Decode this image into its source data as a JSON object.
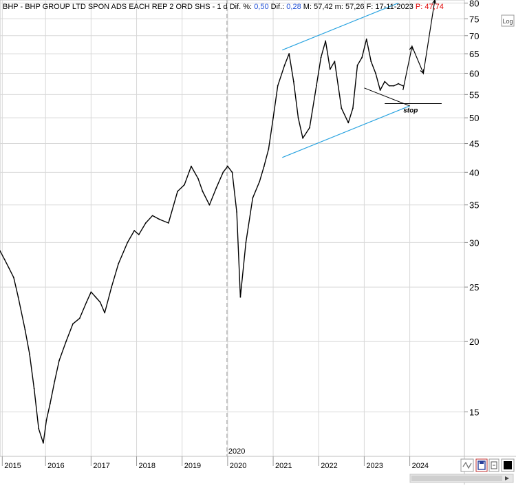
{
  "header": {
    "ticker": "BHP",
    "name": "BHP GROUP LTD SPON ADS EACH REP 2 ORD SHS",
    "timeframe": "1 d",
    "dif_pct_label": "Dif. %:",
    "dif_pct_value": "0,50",
    "dif_label": "Dif.:",
    "dif_value": "0,28",
    "max_label": "M:",
    "max_value": "57,42",
    "min_label": "m:",
    "min_value": "57,26",
    "date_label": "F:",
    "date_value": "17-11-2023",
    "p_label": "P:",
    "p_value": "47,74"
  },
  "buttons": {
    "log_label": "Log"
  },
  "colors": {
    "channel": "#29a3e0",
    "price": "#000000",
    "grid": "#d8d8d8",
    "header_value": "#1f4fd6",
    "header_p": "#e00000"
  },
  "chart_data": {
    "type": "line",
    "title": "",
    "y_scale": "log",
    "ylim": [
      12.5,
      81
    ],
    "xlim": [
      2015.0,
      2025.2
    ],
    "y_ticks": [
      15,
      20,
      25,
      30,
      35,
      40,
      45,
      50,
      55,
      60,
      65,
      70,
      75,
      80
    ],
    "x_ticks": [
      {
        "value": 2015.05,
        "label": "2015"
      },
      {
        "value": 2016.0,
        "label": "2016"
      },
      {
        "value": 2017.0,
        "label": "2017"
      },
      {
        "value": 2018.0,
        "label": "2018"
      },
      {
        "value": 2019.0,
        "label": "2019"
      },
      {
        "value": 2020.0,
        "label": "2020"
      },
      {
        "value": 2021.0,
        "label": "2021"
      },
      {
        "value": 2022.0,
        "label": "2022"
      },
      {
        "value": 2023.0,
        "label": "2023"
      },
      {
        "value": 2024.0,
        "label": "2024"
      }
    ],
    "vertical_marker": {
      "x": 2020.0,
      "label": "2020"
    },
    "series": [
      {
        "x": [
          2015.0,
          2015.1,
          2015.2,
          2015.3,
          2015.4,
          2015.55,
          2015.65,
          2015.75,
          2015.85,
          2015.95,
          2016.02,
          2016.1,
          2016.2,
          2016.3,
          2016.45,
          2016.6,
          2016.75,
          2016.9,
          2017.0,
          2017.1,
          2017.2,
          2017.3,
          2017.45,
          2017.6,
          2017.8,
          2017.95,
          2018.05,
          2018.2,
          2018.35,
          2018.5,
          2018.7,
          2018.9,
          2019.05,
          2019.2,
          2019.35,
          2019.45,
          2019.6,
          2019.75,
          2019.9,
          2020.0,
          2020.1,
          2020.2,
          2020.28,
          2020.4,
          2020.55,
          2020.7,
          2020.8,
          2020.9,
          2021.0,
          2021.1,
          2021.25,
          2021.35,
          2021.45,
          2021.55,
          2021.65,
          2021.8,
          2021.95,
          2022.05,
          2022.15,
          2022.25,
          2022.35,
          2022.5,
          2022.65,
          2022.75,
          2022.85,
          2022.95,
          2023.05,
          2023.15,
          2023.25,
          2023.35,
          2023.45,
          2023.55,
          2023.65,
          2023.75,
          2023.85
        ],
        "values": [
          29.0,
          28.0,
          27.0,
          26.0,
          24.0,
          21.0,
          19.0,
          16.5,
          14.0,
          13.2,
          14.5,
          15.5,
          17.0,
          18.5,
          20.0,
          21.5,
          22.0,
          23.5,
          24.5,
          24.0,
          23.5,
          22.5,
          25.0,
          27.5,
          30.0,
          31.5,
          31.0,
          32.5,
          33.5,
          33.0,
          32.5,
          37.0,
          38.0,
          41.0,
          39.0,
          37.0,
          35.0,
          37.5,
          40.0,
          41.0,
          40.0,
          34.0,
          24.0,
          30.0,
          36.0,
          38.5,
          41.0,
          44.0,
          50.0,
          57.0,
          62.0,
          65.0,
          58.0,
          50.0,
          46.0,
          48.0,
          57.0,
          64.0,
          68.5,
          61.0,
          63.0,
          52.0,
          49.0,
          52.0,
          62.0,
          64.0,
          69.0,
          63.0,
          60.0,
          56.0,
          58.0,
          57.0,
          57.0,
          57.5,
          57.0
        ]
      }
    ],
    "annotations": {
      "channel_upper": {
        "x": [
          2021.2,
          2023.75
        ],
        "y": [
          66.0,
          80.0
        ]
      },
      "channel_lower": {
        "x": [
          2021.2,
          2024.0
        ],
        "y": [
          42.5,
          52.5
        ]
      },
      "down_trendline": {
        "x": [
          2023.0,
          2024.0
        ],
        "y": [
          56.5,
          52.5
        ]
      },
      "stop_line": {
        "x": [
          2023.45,
          2024.7
        ],
        "y": [
          53.0,
          53.0
        ],
        "label": "stop"
      },
      "projection": {
        "x": [
          2023.85,
          2024.05,
          2024.3,
          2024.55
        ],
        "y": [
          56.0,
          67.0,
          60.0,
          81.0
        ]
      }
    }
  }
}
